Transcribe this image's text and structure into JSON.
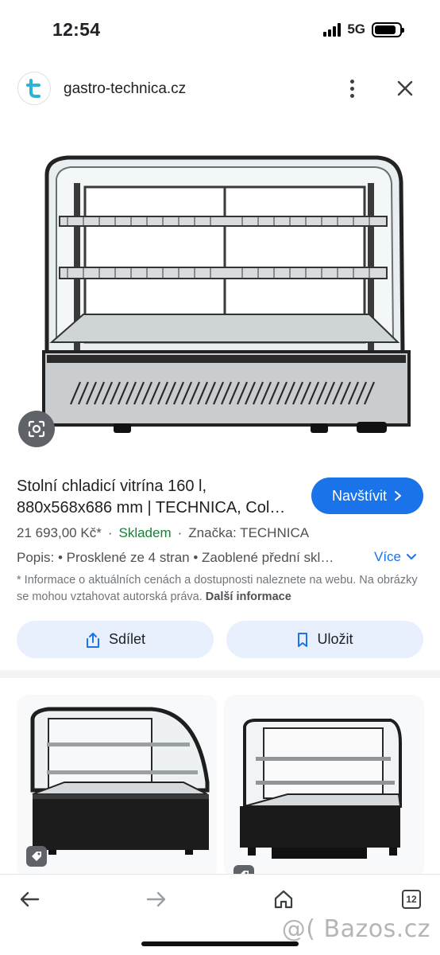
{
  "status_bar": {
    "time": "12:54",
    "network": "5G",
    "battery_level": 0.85
  },
  "header": {
    "site": "gastro-technica.cz",
    "favicon_letter": "t"
  },
  "product": {
    "title_line1": "Stolní chladicí vitrína 160 l,",
    "title_line2": "880x568x686 mm | TECHNICA, Col…",
    "visit_label": "Navštívit",
    "price": "21 693,00 Kč*",
    "stock": "Skladem",
    "brand": "Značka: TECHNICA",
    "description": "Popis: • Prosklené ze 4 stran • Zaoblené přední skl…",
    "more_label": "Více",
    "disclaimer": "* Informace o aktuálních cenách a dostupnosti naleznete na webu. Na obrázky se mohou vztahovat autorská práva.",
    "disclaimer_link": "Další informace"
  },
  "actions": {
    "share_label": "Sdílet",
    "save_label": "Uložit"
  },
  "nav": {
    "tabs_count": "12"
  },
  "watermark": "@( Bazos.cz",
  "colors": {
    "accent": "#1a73e8",
    "pill_bg": "#e8f0fe",
    "stock_green": "#188038"
  }
}
